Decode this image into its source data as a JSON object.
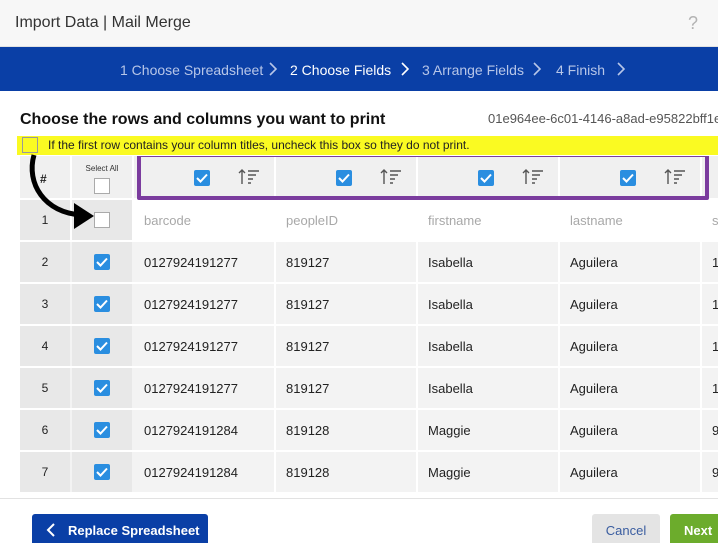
{
  "window": {
    "title": "Import Data | Mail Merge",
    "help_label": "?"
  },
  "steps": [
    {
      "label": "1 Choose Spreadsheet",
      "active": false
    },
    {
      "label": "2 Choose Fields",
      "active": true
    },
    {
      "label": "3 Arrange Fields",
      "active": false
    },
    {
      "label": "4 Finish",
      "active": false
    }
  ],
  "heading": "Choose the rows and columns you want to print",
  "guid": "01e964ee-6c01-4146-a8ad-e95822bff1e",
  "notice": "If the first row contains your column titles, uncheck this box so they do not print.",
  "table": {
    "hash_header": "#",
    "select_all_label": "Select All",
    "columns": [
      "barcode",
      "peopleID",
      "firstname",
      "lastname",
      "s"
    ],
    "rows": [
      {
        "num": "1",
        "checked": false,
        "cells": [
          "barcode",
          "peopleID",
          "firstname",
          "lastname",
          "s"
        ]
      },
      {
        "num": "2",
        "checked": true,
        "cells": [
          "0127924191277",
          "819127",
          "Isabella",
          "Aguilera",
          "1"
        ]
      },
      {
        "num": "3",
        "checked": true,
        "cells": [
          "0127924191277",
          "819127",
          "Isabella",
          "Aguilera",
          "1"
        ]
      },
      {
        "num": "4",
        "checked": true,
        "cells": [
          "0127924191277",
          "819127",
          "Isabella",
          "Aguilera",
          "1"
        ]
      },
      {
        "num": "5",
        "checked": true,
        "cells": [
          "0127924191277",
          "819127",
          "Isabella",
          "Aguilera",
          "1"
        ]
      },
      {
        "num": "6",
        "checked": true,
        "cells": [
          "0127924191284",
          "819128",
          "Maggie",
          "Aguilera",
          "9"
        ]
      },
      {
        "num": "7",
        "checked": true,
        "cells": [
          "0127924191284",
          "819128",
          "Maggie",
          "Aguilera",
          "9"
        ]
      }
    ]
  },
  "footer": {
    "back_label": "Replace Spreadsheet",
    "cancel_label": "Cancel",
    "next_label": "Next"
  },
  "colors": {
    "brand": "#0a3fa6",
    "highlight": "#7b3c9e",
    "notice": "#fafa22",
    "next": "#6cac2c",
    "checkbox": "#2a8ee0"
  }
}
